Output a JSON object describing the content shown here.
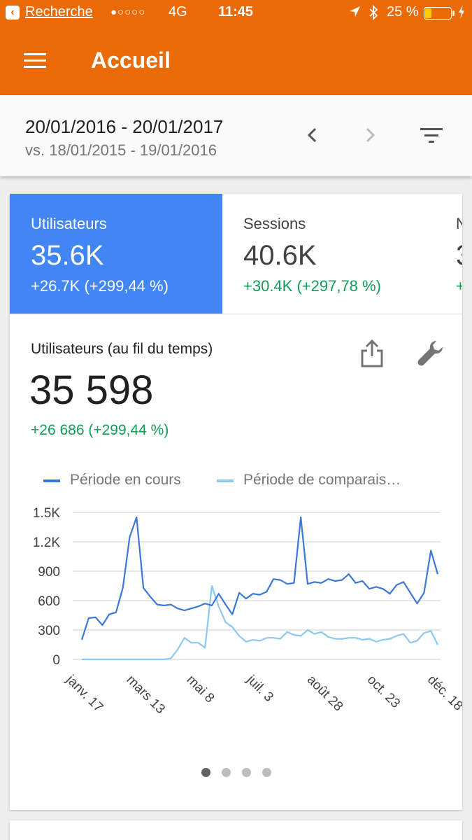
{
  "status_bar": {
    "back_label": "Recherche",
    "signal": "●○○○○",
    "network": "4G",
    "time": "11:45",
    "battery_pct": "25 %",
    "battery_level": 0.25,
    "icons": [
      "back-icon",
      "location-icon",
      "bluetooth-icon",
      "battery-icon",
      "charging-icon"
    ]
  },
  "app_bar": {
    "title": "Accueil",
    "menu_icon": "hamburger-menu-icon"
  },
  "date_range": {
    "current": "20/01/2016 - 20/01/2017",
    "comparison": "vs. 18/01/2015 - 19/01/2016"
  },
  "metric_tabs": [
    {
      "label": "Utilisateurs",
      "value": "35.6K",
      "delta": "+26.7K (+299,44 %)",
      "active": true
    },
    {
      "label": "Sessions",
      "value": "40.6K",
      "delta": "+30.4K (+297,78 %)",
      "active": false
    },
    {
      "label": "N",
      "value": "3",
      "delta": "+",
      "active": false
    }
  ],
  "metric_detail": {
    "title": "Utilisateurs (au fil du temps)",
    "value": "35 598",
    "delta": "+26 686 (+299,44 %)"
  },
  "chart_data": {
    "type": "line",
    "legend": [
      "Période en cours",
      "Période de comparais…"
    ],
    "y_ticks": [
      "0",
      "300",
      "600",
      "900",
      "1.2K",
      "1.5K"
    ],
    "y_range": [
      0,
      1500
    ],
    "x_labels": [
      "janv. 17",
      "mars 13",
      "mai 8",
      "juil. 3",
      "août 28",
      "oct. 23",
      "déc. 18"
    ],
    "grid": true,
    "colors": {
      "current": "#3b78d8",
      "comparison": "#8cc8f0"
    },
    "series": [
      {
        "name": "Période en cours",
        "values": [
          200,
          420,
          430,
          350,
          460,
          480,
          730,
          1250,
          1450,
          730,
          640,
          560,
          550,
          560,
          520,
          500,
          520,
          540,
          570,
          550,
          670,
          560,
          460,
          680,
          620,
          670,
          660,
          690,
          820,
          810,
          770,
          780,
          1450,
          770,
          790,
          780,
          820,
          800,
          810,
          870,
          780,
          800,
          720,
          740,
          720,
          670,
          760,
          790,
          680,
          570,
          680,
          1110,
          870
        ]
      },
      {
        "name": "Période de comparais…",
        "values": [
          0,
          0,
          0,
          0,
          0,
          0,
          0,
          0,
          0,
          0,
          0,
          0,
          0,
          10,
          100,
          220,
          170,
          170,
          120,
          750,
          540,
          380,
          330,
          240,
          180,
          200,
          190,
          220,
          220,
          210,
          280,
          250,
          240,
          300,
          260,
          280,
          230,
          210,
          210,
          220,
          220,
          200,
          210,
          180,
          200,
          210,
          240,
          260,
          170,
          190,
          270,
          290,
          150
        ]
      }
    ]
  },
  "pagination": {
    "count": 4,
    "active_index": 0
  }
}
